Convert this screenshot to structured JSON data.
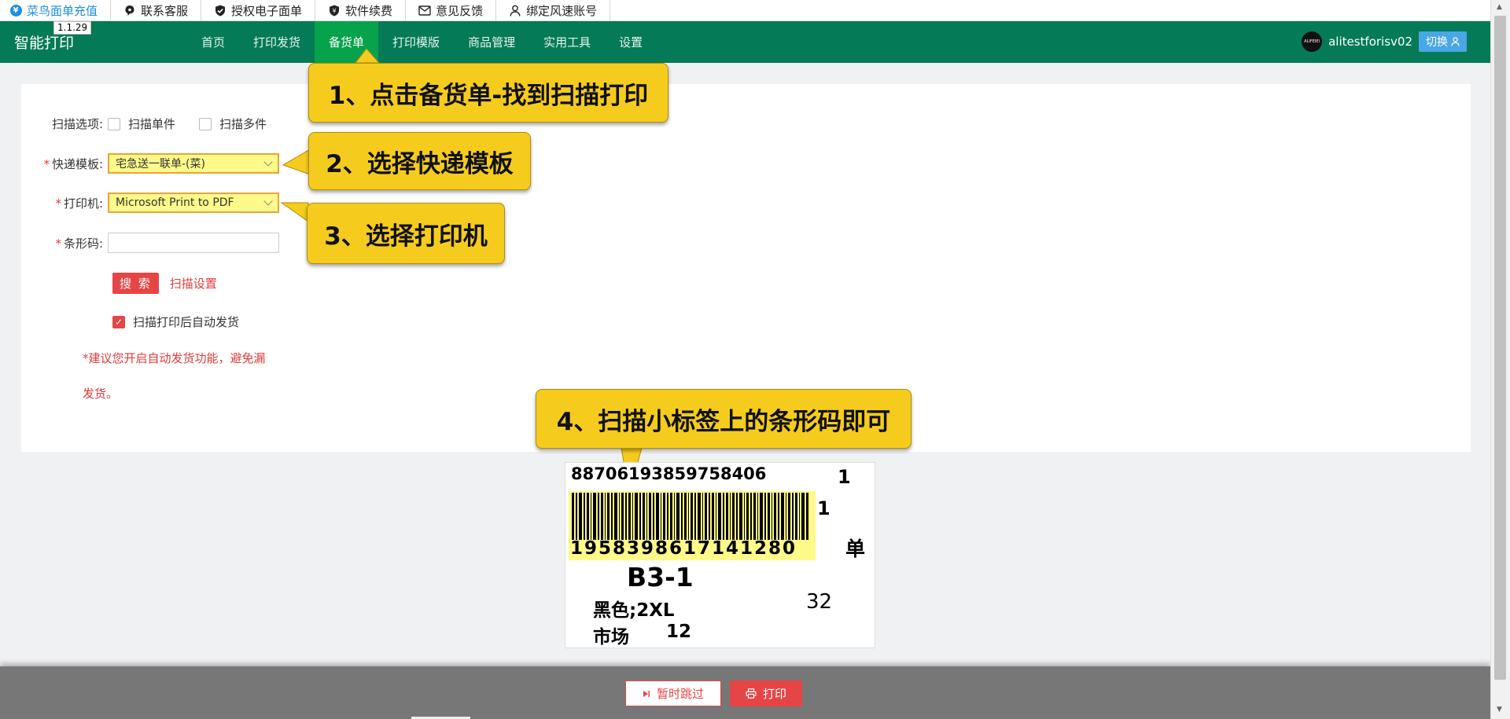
{
  "topbar": {
    "items": [
      {
        "label": "菜鸟面单充值",
        "icon": "yuan-coin-icon"
      },
      {
        "label": "联系客服",
        "icon": "chat-bubble-icon"
      },
      {
        "label": "授权电子面单",
        "icon": "shield-check-icon"
      },
      {
        "label": "软件续费",
        "icon": "shield-yen-icon"
      },
      {
        "label": "意见反馈",
        "icon": "mail-icon"
      },
      {
        "label": "绑定风速账号",
        "icon": "user-icon"
      }
    ]
  },
  "nav": {
    "brand": "智能打印",
    "version": "1.1.29",
    "menu": [
      "首页",
      "打印发货",
      "备货单",
      "打印模版",
      "商品管理",
      "实用工具",
      "设置"
    ],
    "active_index": 2,
    "username": "alitestforisv02",
    "avatar_text": "ALIFEIEI",
    "switch_label": "切换"
  },
  "form": {
    "scan_option_label": "扫描选项:",
    "scan_single": "扫描单件",
    "scan_multi": "扫描多件",
    "template_label": "快递模板:",
    "template_value": "宅急送一联单-(菜)",
    "printer_label": "打印机:",
    "printer_value": "Microsoft Print to PDF",
    "barcode_label": "条形码:",
    "barcode_value": "",
    "search_btn": "搜 索",
    "scan_settings": "扫描设置",
    "auto_ship_label": "扫描打印后自动发货",
    "auto_ship_checked": true,
    "tip_line1": "*建议您开启自动发货功能，避免漏",
    "tip_line2": "发货。"
  },
  "callouts": [
    "1、点击备货单-找到扫描打印",
    "2、选择快递模板",
    "3、选择打印机",
    "4、扫描小标签上的条形码即可"
  ],
  "label": {
    "order_number": "88706193859758406",
    "qty_top": "1",
    "qty_second": "1",
    "dan": "单",
    "barcode": "1958398617141280",
    "location": "B3-1",
    "spec": "黑色;2XL",
    "size_num": "32",
    "market": "市场",
    "market_num": "12"
  },
  "bottom": {
    "skip_label": "暂时跳过",
    "print_label": "打印"
  },
  "colors": {
    "nav_green": "#047a56",
    "active_tab": "#07a24c",
    "accent_red": "#e64545",
    "callout_yellow": "#f5cc1e",
    "highlight_yellow": "#fdfa8a"
  }
}
